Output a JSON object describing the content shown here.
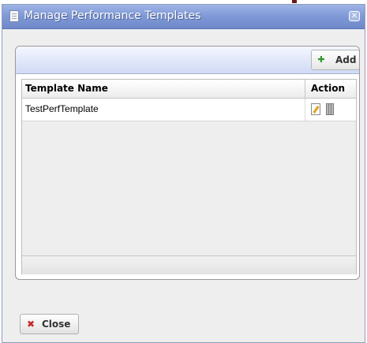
{
  "dialog": {
    "title": "Manage Performance Templates",
    "close_glyph": "✕",
    "title_icon": "document-icon"
  },
  "toolbar": {
    "add_label": "Add",
    "add_icon": "plus-icon",
    "add_icon_color": "#2e9a2e"
  },
  "table": {
    "columns": [
      "Template Name",
      "Action"
    ],
    "rows": [
      {
        "name": "TestPerfTemplate",
        "actions": [
          "edit-icon",
          "delete-icon"
        ]
      }
    ]
  },
  "footer": {
    "close_label": "Close",
    "close_icon": "x-icon",
    "close_icon_color": "#c62a2a"
  },
  "colors": {
    "titlebar": "#7f98d6",
    "dialog_bg": "#eeeeee"
  }
}
